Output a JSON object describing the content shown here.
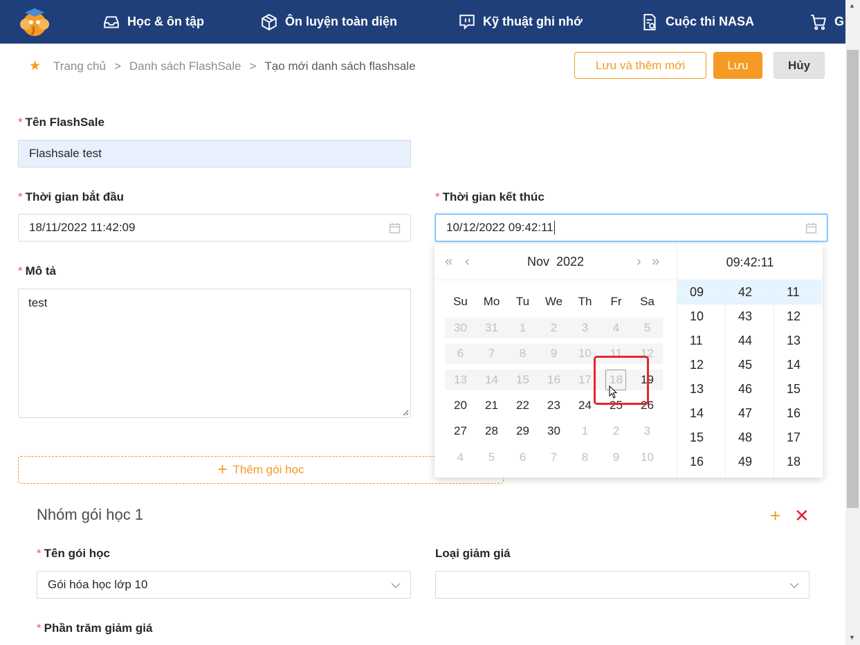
{
  "nav": {
    "items": [
      {
        "label": "Học & ôn tập",
        "icon": "inbox-icon"
      },
      {
        "label": "Ôn luyện toàn diện",
        "icon": "box-icon"
      },
      {
        "label": "Kỹ thuật ghi nhớ",
        "icon": "chat-icon"
      },
      {
        "label": "Cuộc thi NASA",
        "icon": "document-icon"
      },
      {
        "label": "G",
        "icon": "cart-icon"
      }
    ]
  },
  "breadcrumb": {
    "home": "Trang chủ",
    "list": "Danh sách FlashSale",
    "current": "Tạo mới danh sách flashsale",
    "sep": ">"
  },
  "actions": {
    "save_new": "Lưu và thêm mới",
    "save": "Lưu",
    "cancel": "Hủy"
  },
  "form": {
    "name_label": "Tên FlashSale",
    "name_value": "Flashsale test",
    "start_label": "Thời gian bắt đầu",
    "start_value": "18/11/2022 11:42:09",
    "end_label": "Thời gian kết thúc",
    "end_value": "10/12/2022 09:42:11",
    "desc_label": "Mô tả",
    "desc_value": "test",
    "add_package": "Thêm gói học"
  },
  "group": {
    "title": "Nhóm gói học 1",
    "package_label": "Tên gói học",
    "package_value": "Gói hóa học lớp 10",
    "discount_type_label": "Loại giảm giá",
    "discount_type_value": "",
    "percent_label": "Phần trăm giảm giá"
  },
  "picker": {
    "month": "Nov",
    "year": "2022",
    "time": "09:42:11",
    "weekdays": [
      "Su",
      "Mo",
      "Tu",
      "We",
      "Th",
      "Fr",
      "Sa"
    ],
    "weeks": [
      [
        "30",
        "31",
        "1",
        "2",
        "3",
        "4",
        "5"
      ],
      [
        "6",
        "7",
        "8",
        "9",
        "10",
        "11",
        "12"
      ],
      [
        "13",
        "14",
        "15",
        "16",
        "17",
        "18",
        "19"
      ],
      [
        "20",
        "21",
        "22",
        "23",
        "24",
        "25",
        "26"
      ],
      [
        "27",
        "28",
        "29",
        "30",
        "1",
        "2",
        "3"
      ],
      [
        "4",
        "5",
        "6",
        "7",
        "8",
        "9",
        "10"
      ]
    ],
    "hours": [
      "09",
      "10",
      "11",
      "12",
      "13",
      "14",
      "15",
      "16"
    ],
    "minutes": [
      "42",
      "43",
      "44",
      "45",
      "46",
      "47",
      "48",
      "49"
    ],
    "seconds": [
      "11",
      "12",
      "13",
      "14",
      "15",
      "16",
      "17",
      "18"
    ]
  },
  "colors": {
    "nav_bg": "#1f3f7a",
    "accent": "#f59a23",
    "required": "#ff4d4f",
    "highlight": "#e3262f"
  }
}
